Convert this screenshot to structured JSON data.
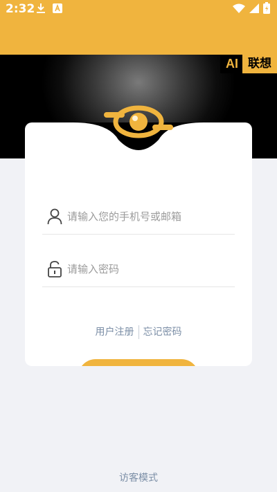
{
  "status_bar": {
    "time": "2:32",
    "left_icons": [
      "download-icon",
      "a-notification-icon"
    ],
    "right_icons": [
      "wifi-icon",
      "signal-icon",
      "battery-charging-icon"
    ],
    "background_color": "#f0b43e"
  },
  "brand": {
    "ai": "AI",
    "name": "联想"
  },
  "form": {
    "account_placeholder": "请输入您的手机号或邮箱",
    "account_value": "",
    "password_placeholder": "请输入密码",
    "password_value": ""
  },
  "links": {
    "register": "用户注册",
    "forgot": "忘记密码"
  },
  "guest": {
    "label": "访客模式"
  },
  "colors": {
    "accent": "#f0b43e",
    "link": "#7b8ea6",
    "page_bg": "#f1f2f6"
  }
}
